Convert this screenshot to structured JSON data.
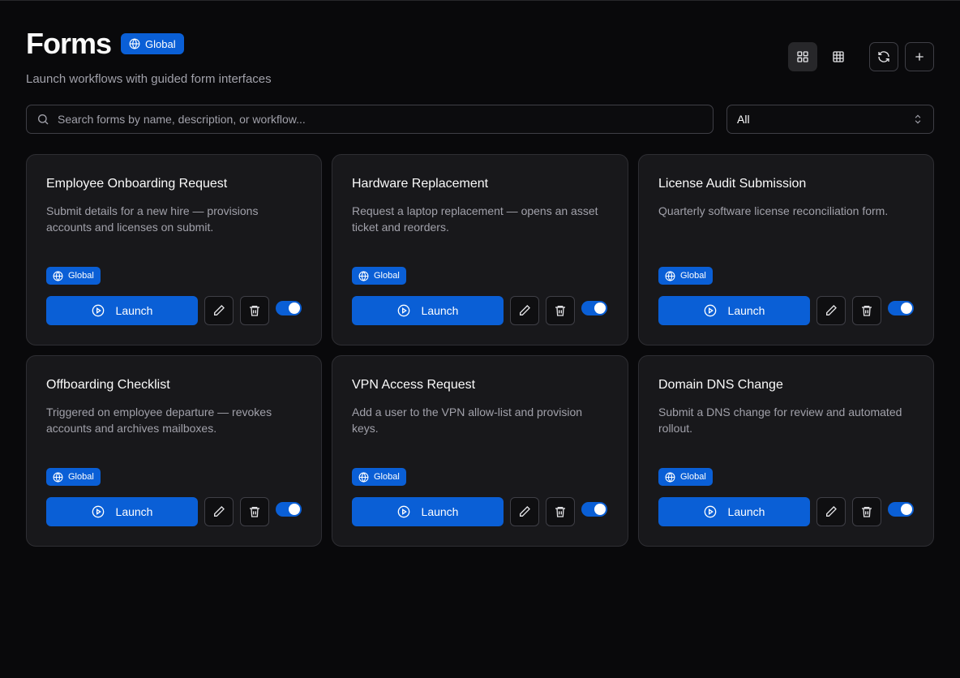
{
  "header": {
    "title": "Forms",
    "scope_badge": "Global",
    "subtitle": "Launch workflows with guided form interfaces"
  },
  "toolbar": {
    "icons": [
      "grid-view-icon",
      "table-view-icon",
      "refresh-icon",
      "plus-icon"
    ],
    "active_view": "grid"
  },
  "search": {
    "placeholder": "Search forms by name, description, or workflow...",
    "value": ""
  },
  "filter": {
    "selected": "All"
  },
  "colors": {
    "accent": "#0a5fd6",
    "background": "#09090b",
    "card": "#18181b"
  },
  "cards": [
    {
      "title": "Employee Onboarding Request",
      "description": "Submit details for a new hire — provisions accounts and licenses on submit.",
      "badge": "Global",
      "launch_label": "Launch",
      "enabled": true
    },
    {
      "title": "Hardware Replacement",
      "description": "Request a laptop replacement — opens an asset ticket and reorders.",
      "badge": "Global",
      "launch_label": "Launch",
      "enabled": true
    },
    {
      "title": "License Audit Submission",
      "description": "Quarterly software license reconciliation form.",
      "badge": "Global",
      "launch_label": "Launch",
      "enabled": true
    },
    {
      "title": "Offboarding Checklist",
      "description": "Triggered on employee departure — revokes accounts and archives mailboxes.",
      "badge": "Global",
      "launch_label": "Launch",
      "enabled": true
    },
    {
      "title": "VPN Access Request",
      "description": "Add a user to the VPN allow-list and provision keys.",
      "badge": "Global",
      "launch_label": "Launch",
      "enabled": true
    },
    {
      "title": "Domain DNS Change",
      "description": "Submit a DNS change for review and automated rollout.",
      "badge": "Global",
      "launch_label": "Launch",
      "enabled": true
    }
  ]
}
